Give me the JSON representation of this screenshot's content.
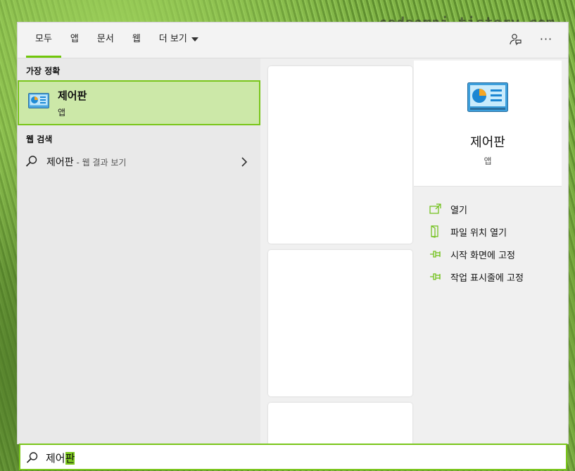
{
  "watermark": "codeomni.tistory.com",
  "tabs": [
    {
      "label": "모두"
    },
    {
      "label": "앱"
    },
    {
      "label": "문서"
    },
    {
      "label": "웹"
    },
    {
      "label": "더 보기"
    }
  ],
  "top_icons": {
    "feedback": "feedback-person-icon",
    "more": "···"
  },
  "best_match": {
    "section_title": "가장 정확",
    "name": "제어판",
    "kind": "앱",
    "icon": "control-panel-icon"
  },
  "web_search": {
    "section_title": "웹 검색",
    "query": "제어판",
    "suffix": " - 웹 결과 보기"
  },
  "detail": {
    "name": "제어판",
    "kind": "앱",
    "actions": [
      {
        "label": "열기",
        "icon": "open-icon"
      },
      {
        "label": "파일 위치 열기",
        "icon": "file-location-icon"
      },
      {
        "label": "시작 화면에 고정",
        "icon": "pin-icon"
      },
      {
        "label": "작업 표시줄에 고정",
        "icon": "pin-icon"
      }
    ]
  },
  "search_box": {
    "typed_prefix": "제어",
    "typed_selected": "판"
  },
  "colors": {
    "accent": "#70c60a",
    "highlight": "#cce8a8"
  }
}
